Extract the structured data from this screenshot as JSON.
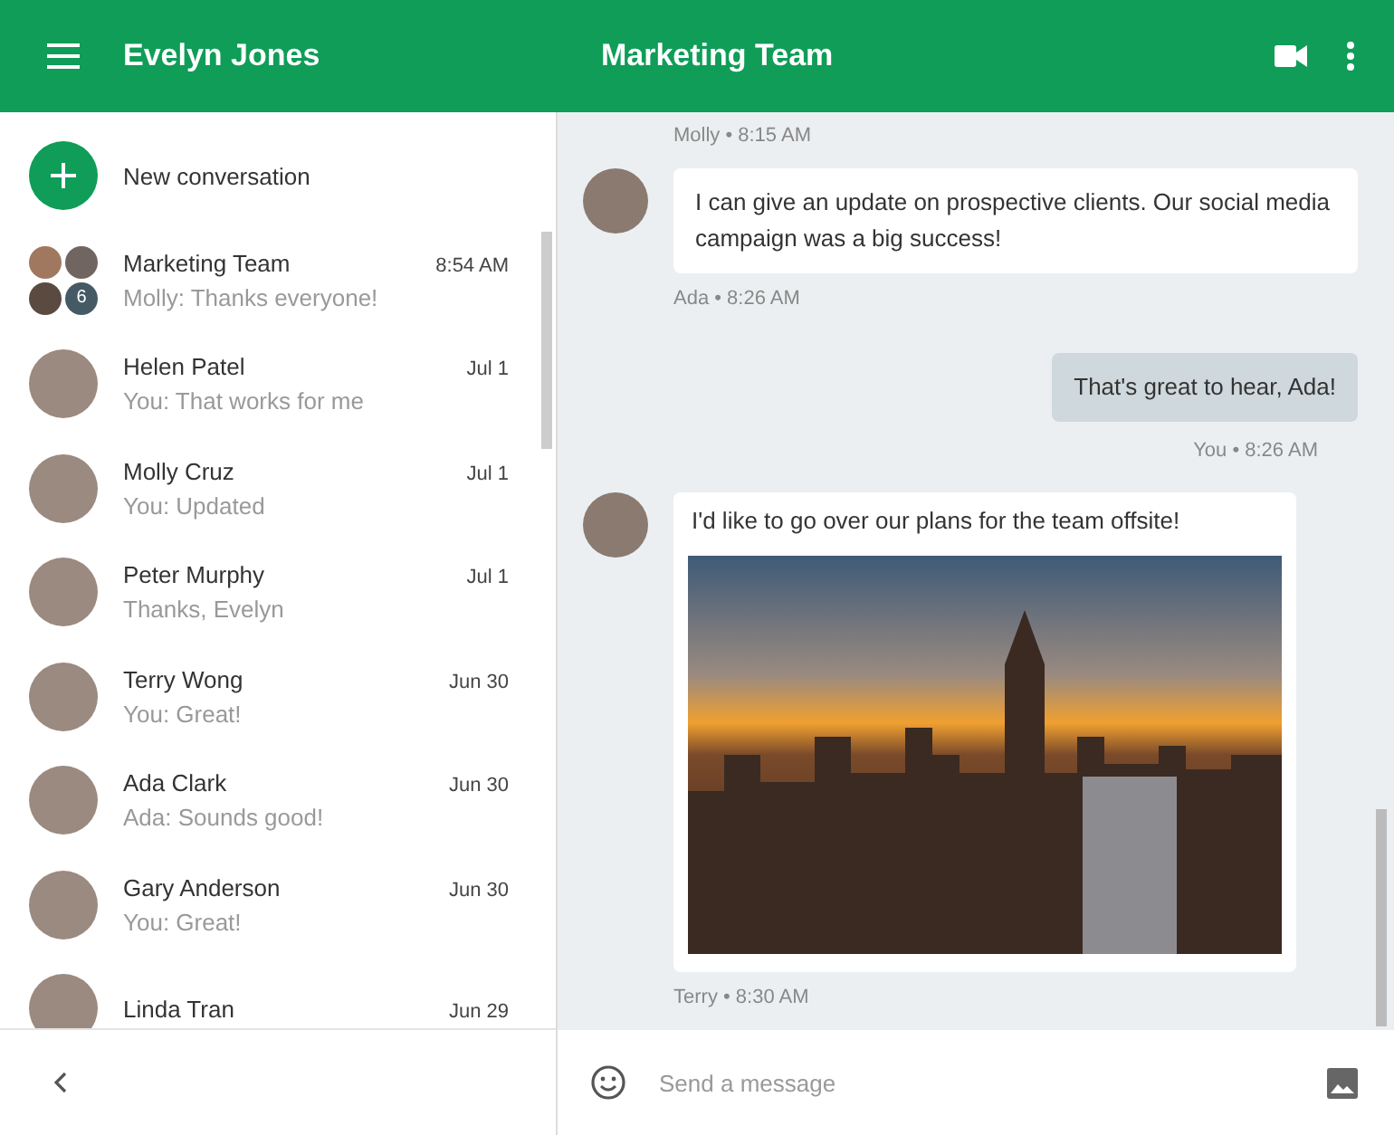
{
  "sidebar": {
    "user_name": "Evelyn Jones",
    "new_conversation": "New conversation",
    "conversations": [
      {
        "name": "Marketing Team",
        "preview": "Molly: Thanks everyone!",
        "time": "8:54 AM",
        "kind": "group",
        "badge": "6",
        "selected": false
      },
      {
        "name": "Helen Patel",
        "preview": "You: That works for me",
        "time": "Jul 1",
        "kind": "person",
        "selected": false
      },
      {
        "name": "Molly Cruz",
        "preview": "You: Updated",
        "time": "Jul 1",
        "kind": "person",
        "selected": false
      },
      {
        "name": "Peter Murphy",
        "preview": "Thanks, Evelyn",
        "time": "Jul 1",
        "kind": "person",
        "selected": false
      },
      {
        "name": "Terry Wong",
        "preview": "You: Great!",
        "time": "Jun 30",
        "kind": "person",
        "selected": false
      },
      {
        "name": "Ada Clark",
        "preview": "Ada: Sounds good!",
        "time": "Jun 30",
        "kind": "person",
        "selected": false
      },
      {
        "name": "Gary Anderson",
        "preview": "You: Great!",
        "time": "Jun 30",
        "kind": "person",
        "selected": false
      },
      {
        "name": "Linda Tran",
        "time": "Jun 29",
        "kind": "person",
        "selected": false
      }
    ]
  },
  "chat": {
    "title": "Marketing Team",
    "messages": [
      {
        "kind": "meta",
        "text": "Molly • 8:15 AM"
      },
      {
        "kind": "incoming",
        "text": "I can give an update on prospective clients. Our social media campaign was a big success!"
      },
      {
        "kind": "meta",
        "text": "Ada • 8:26 AM"
      },
      {
        "kind": "outgoing",
        "text": "That's great to hear, Ada!"
      },
      {
        "kind": "meta-right",
        "text": "You • 8:26 AM"
      },
      {
        "kind": "image",
        "text": "I'd like to go over our plans for the team offsite!"
      },
      {
        "kind": "meta",
        "text": "Terry • 8:30 AM"
      }
    ],
    "composer": {
      "placeholder": "Send a message"
    }
  }
}
